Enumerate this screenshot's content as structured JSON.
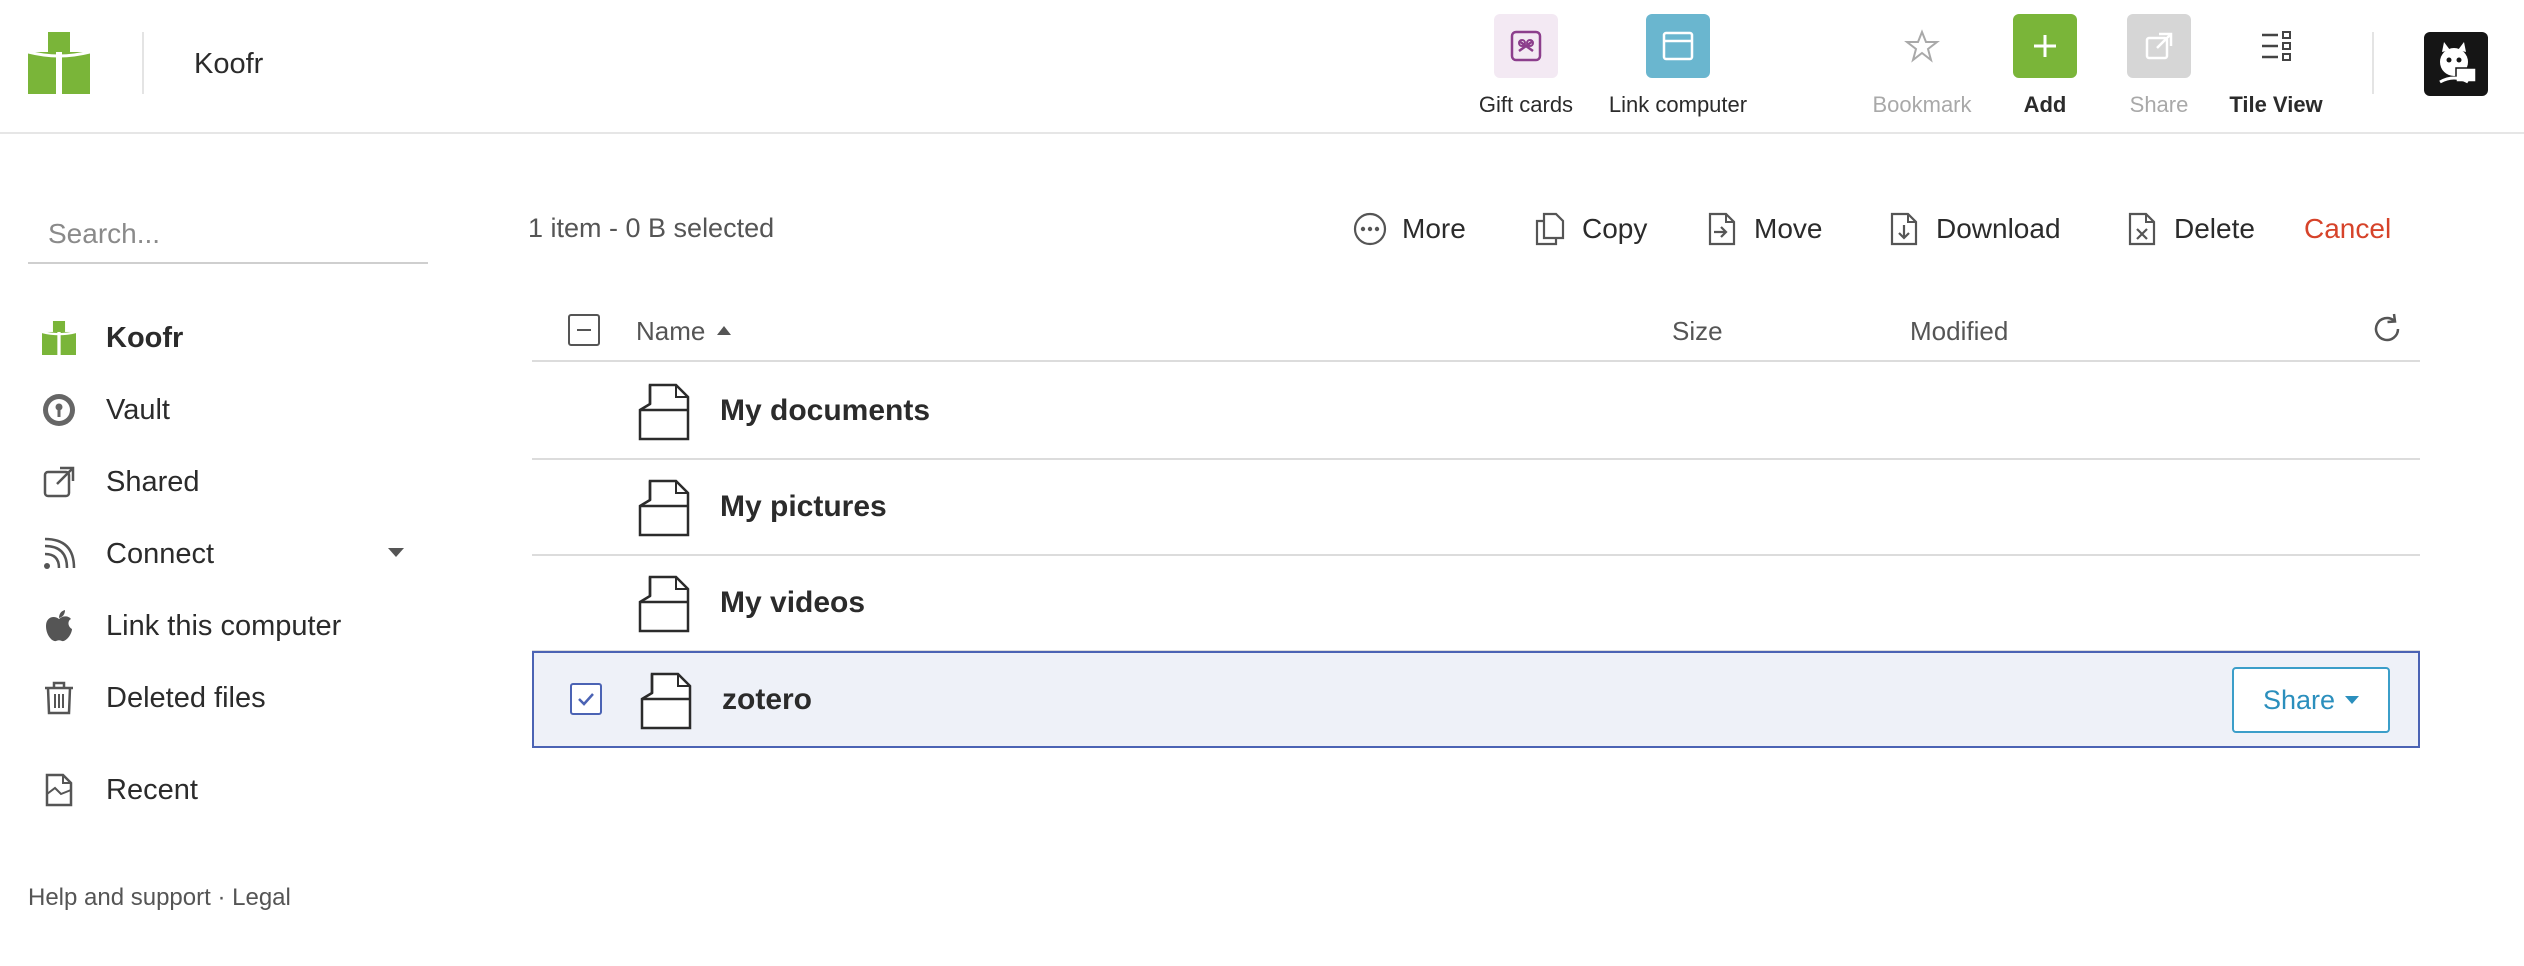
{
  "header": {
    "title": "Koofr",
    "tools": {
      "gift_cards": "Gift cards",
      "link_computer": "Link computer",
      "bookmark": "Bookmark",
      "add": "Add",
      "share": "Share",
      "tile_view": "Tile View"
    },
    "colors": {
      "brand_green": "#7ab539",
      "link_blue": "#6ab6cf",
      "gift_bg": "#f3e9f3",
      "gift_icon": "#8c3e8c",
      "disabled": "#d6d6d6"
    }
  },
  "sidebar": {
    "search_placeholder": "Search...",
    "items": [
      {
        "label": "Koofr",
        "icon": "koofr-logo-icon",
        "active": true
      },
      {
        "label": "Vault",
        "icon": "vault-icon"
      },
      {
        "label": "Shared",
        "icon": "external-link-icon"
      },
      {
        "label": "Connect",
        "icon": "rss-icon",
        "has_dropdown": true
      },
      {
        "label": "Link this computer",
        "icon": "apple-icon"
      },
      {
        "label": "Deleted files",
        "icon": "trash-icon"
      },
      {
        "label": "Recent",
        "icon": "recent-file-icon"
      }
    ],
    "footer": {
      "help": "Help and support",
      "separator": " · ",
      "legal": "Legal"
    }
  },
  "toolbar": {
    "selection_info": "1 item - 0 B selected",
    "actions": {
      "more": "More",
      "copy": "Copy",
      "move": "Move",
      "download": "Download",
      "delete": "Delete",
      "cancel": "Cancel"
    }
  },
  "table": {
    "columns": {
      "name": "Name",
      "size": "Size",
      "modified": "Modified"
    },
    "sort": {
      "column": "Name",
      "direction": "ascending"
    },
    "rows": [
      {
        "name": "My documents",
        "selected": false
      },
      {
        "name": "My pictures",
        "selected": false
      },
      {
        "name": "My videos",
        "selected": false
      },
      {
        "name": "zotero",
        "selected": true,
        "share_label": "Share"
      }
    ]
  }
}
